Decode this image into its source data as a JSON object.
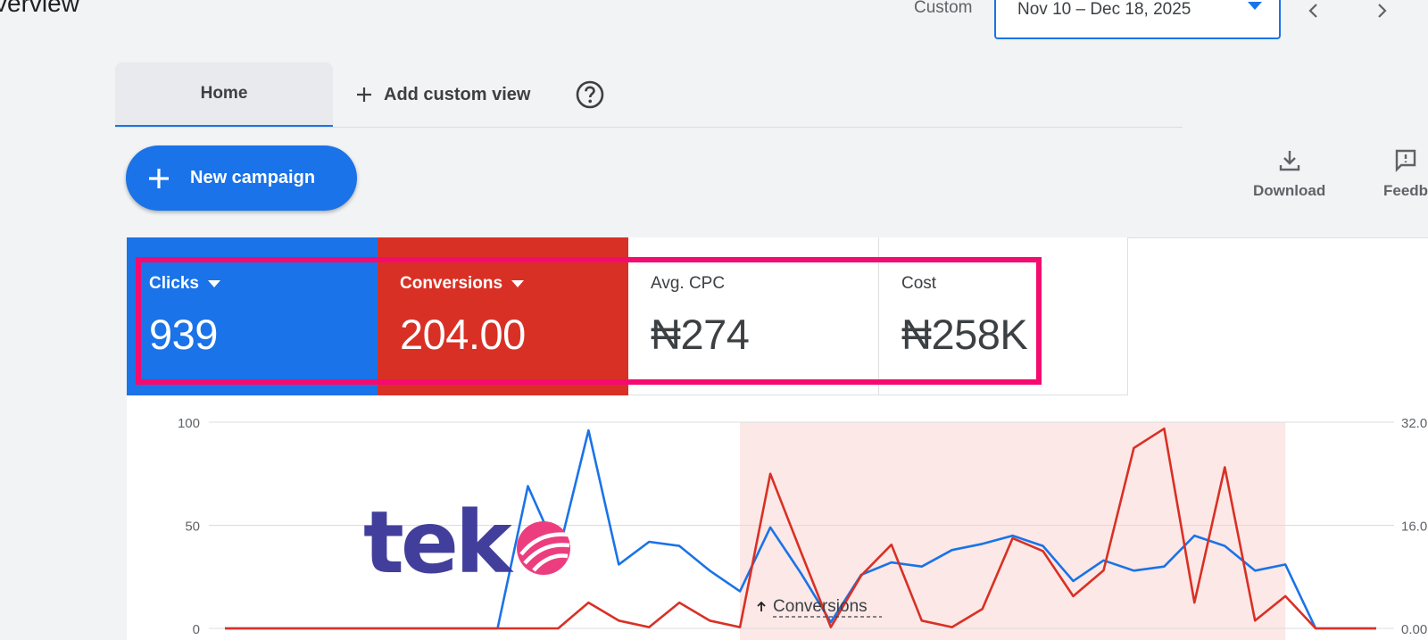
{
  "header": {
    "title": "verview",
    "date_range_label": "Custom",
    "date_range_value": "Nov 10 – Dec 18, 2025"
  },
  "tabs": {
    "home": "Home",
    "add_custom_view": "Add custom view"
  },
  "actions": {
    "new_campaign": "New campaign",
    "download": "Download",
    "feedback": "Feedb"
  },
  "metrics": [
    {
      "label": "Clicks",
      "value": "939",
      "color": "#1a73e8"
    },
    {
      "label": "Conversions",
      "value": "204.00",
      "color": "#d93025"
    },
    {
      "label": "Avg. CPC",
      "value": "₦274"
    },
    {
      "label": "Cost",
      "value": "₦258K"
    }
  ],
  "watermark": {
    "text": "tek"
  },
  "chart_data": {
    "type": "line",
    "x": [
      0,
      1,
      2,
      3,
      4,
      5,
      6,
      7,
      8,
      9,
      10,
      11,
      12,
      13,
      14,
      15,
      16,
      17,
      18,
      19,
      20,
      21,
      22,
      23,
      24,
      25,
      26,
      27,
      28,
      29,
      30,
      31,
      32,
      33,
      34,
      35,
      36,
      37,
      38
    ],
    "series": [
      {
        "color": "#1a73e8",
        "axis": "left",
        "values": [
          0,
          0,
          0,
          0,
          0,
          0,
          0,
          0,
          0,
          0,
          69,
          36,
          96,
          31,
          42,
          40,
          28,
          18,
          49,
          27,
          3,
          26,
          32,
          30,
          38,
          41,
          45,
          40,
          23,
          33,
          28,
          30,
          45,
          40,
          28,
          31,
          0,
          0,
          0
        ]
      },
      {
        "color": "#d93025",
        "axis": "right",
        "values": [
          0,
          0,
          0,
          0,
          0,
          0,
          0,
          0,
          0,
          0,
          0,
          0,
          4,
          1.2,
          0.2,
          4,
          1.2,
          0.2,
          24,
          12,
          0.2,
          8.2,
          13,
          1.2,
          0.2,
          3,
          14,
          12,
          5,
          9,
          28,
          31,
          4,
          25,
          1.2,
          5,
          0,
          0,
          0
        ]
      }
    ],
    "left_ticks": [
      "100",
      "50",
      "0"
    ],
    "right_ticks": [
      "32.0",
      "16.0",
      "0.00"
    ],
    "ylim_left": [
      0,
      100
    ],
    "ylim_right": [
      0,
      32
    ],
    "shaded_range": [
      17,
      35
    ],
    "annotation": "Conversions",
    "annotation_x": 18,
    "grid": true
  }
}
